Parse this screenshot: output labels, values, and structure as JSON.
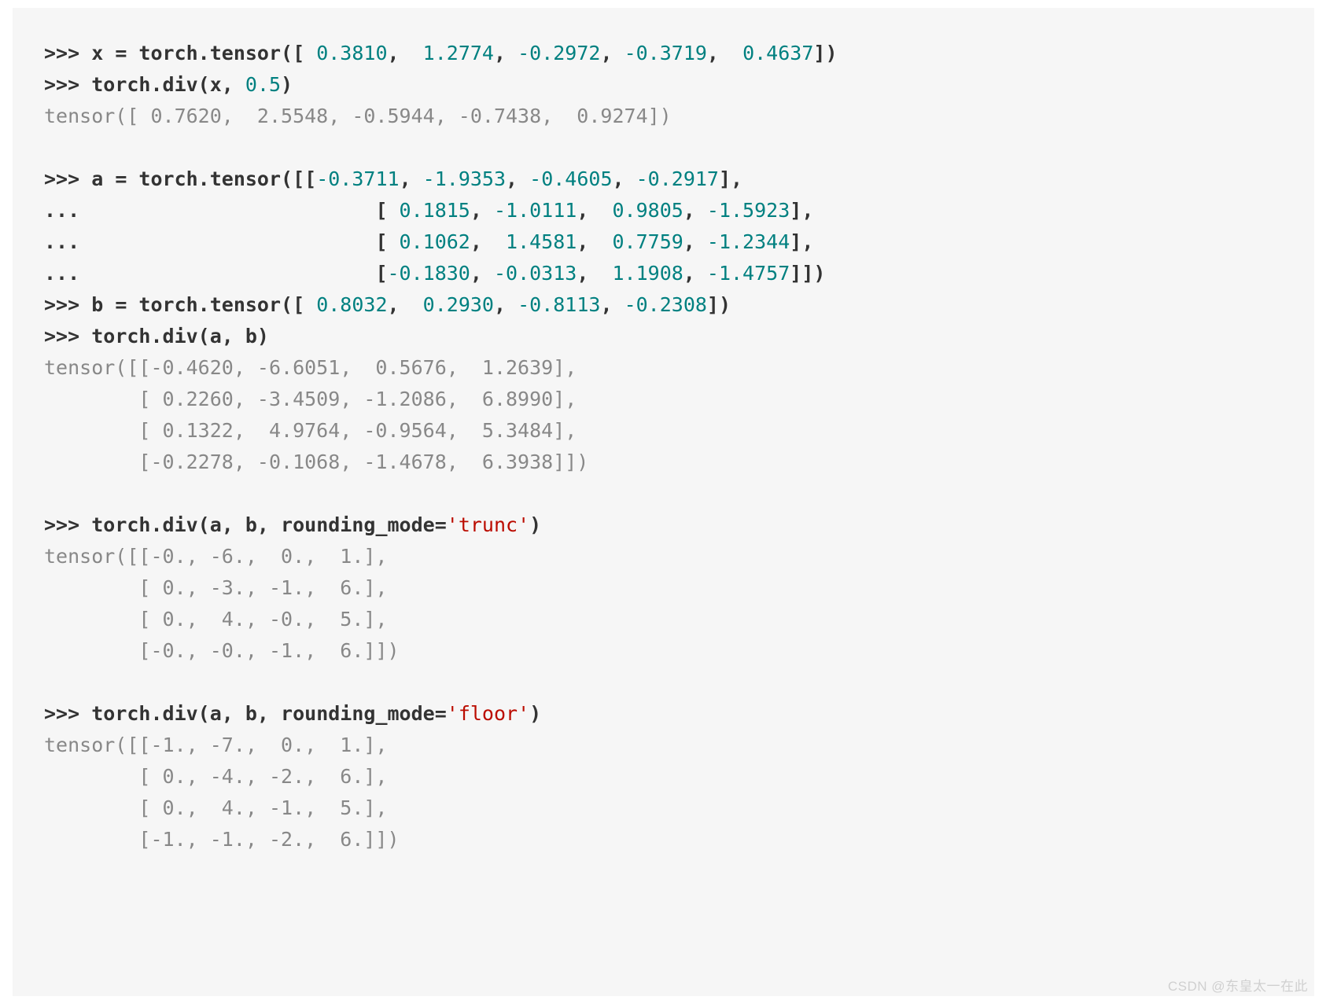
{
  "chart_data": {
    "type": "table",
    "title": "Python REPL session demonstrating torch.div",
    "inputs": [
      {
        "stmt": "x = torch.tensor([ 0.3810,  1.2774, -0.2972, -0.3719,  0.4637])"
      },
      {
        "stmt": "torch.div(x, 0.5)",
        "output": "tensor([ 0.7620,  2.5548, -0.5944, -0.7438,  0.9274])"
      },
      {
        "stmt": "a = torch.tensor([[-0.3711, -1.9353, -0.4605, -0.2917],[ 0.1815, -1.0111,  0.9805, -1.5923],[ 0.1062,  1.4581,  0.7759, -1.2344],[-0.1830, -0.0313,  1.1908, -1.4757]])"
      },
      {
        "stmt": "b = torch.tensor([ 0.8032,  0.2930, -0.8113, -0.2308])"
      },
      {
        "stmt": "torch.div(a, b)",
        "output": "tensor([[-0.4620, -6.6051,  0.5676,  1.2639],[ 0.2260, -3.4509, -1.2086,  6.8990],[ 0.1322,  4.9764, -0.9564,  5.3484],[-0.2278, -0.1068, -1.4678,  6.3938]])"
      },
      {
        "stmt": "torch.div(a, b, rounding_mode='trunc')",
        "output": "tensor([[-0., -6.,  0.,  1.],[ 0., -3., -1.,  6.],[ 0.,  4., -0.,  5.],[-0., -0., -1.,  6.]])"
      },
      {
        "stmt": "torch.div(a, b, rounding_mode='floor')",
        "output": "tensor([[-1., -7.,  0.,  1.],[ 0., -4., -2.,  6.],[ 0.,  4., -1.,  5.],[-1., -1., -2.,  6.]])"
      }
    ]
  },
  "tok": {
    "prompt": ">>> ",
    "cont": "...                         ",
    "x_assign": "x = torch.tensor([ ",
    "x_vals": [
      "0.3810",
      "1.2774",
      "-0.2972",
      "-0.3719",
      "0.4637"
    ],
    "x_close": "])",
    "divx_call": "torch.div(x, ",
    "divx_arg": "0.5",
    "divx_close": ")",
    "divx_out": "tensor([ 0.7620,  2.5548, -0.5944, -0.7438,  0.9274])",
    "a_assign": "a = torch.tensor([[",
    "a_r1": [
      "-0.3711",
      "-1.9353",
      "-0.4605",
      "-0.2917"
    ],
    "a_r2": [
      "0.1815",
      "-1.0111",
      "0.9805",
      "-1.5923"
    ],
    "a_r3": [
      "0.1062",
      "1.4581",
      "0.7759",
      "-1.2344"
    ],
    "a_r4": [
      "-0.1830",
      "-0.0313",
      "1.1908",
      "-1.4757"
    ],
    "row_open_sp": "[ ",
    "row_open": "[",
    "row_close_c": "],",
    "row_close_e": "]])",
    "b_assign": "b = torch.tensor([ ",
    "b_vals": [
      "0.8032",
      "0.2930",
      "-0.8113",
      "-0.2308"
    ],
    "b_close": "])",
    "divab": "torch.div(a, b)",
    "divab_out1": "tensor([[-0.4620, -6.6051,  0.5676,  1.2639],",
    "divab_out2": "        [ 0.2260, -3.4509, -1.2086,  6.8990],",
    "divab_out3": "        [ 0.1322,  4.9764, -0.9564,  5.3484],",
    "divab_out4": "        [-0.2278, -0.1068, -1.4678,  6.3938]])",
    "divtrunc_pre": "torch.div(a, b, rounding_mode=",
    "str_trunc": "'trunc'",
    "close_paren": ")",
    "trunc_out1": "tensor([[-0., -6.,  0.,  1.],",
    "trunc_out2": "        [ 0., -3., -1.,  6.],",
    "trunc_out3": "        [ 0.,  4., -0.,  5.],",
    "trunc_out4": "        [-0., -0., -1.,  6.]])",
    "divfloor_pre": "torch.div(a, b, rounding_mode=",
    "str_floor": "'floor'",
    "floor_out1": "tensor([[-1., -7.,  0.,  1.],",
    "floor_out2": "        [ 0., -4., -2.,  6.],",
    "floor_out3": "        [ 0.,  4., -1.,  5.],",
    "floor_out4": "        [-1., -1., -2.,  6.]])",
    "sep2": ",  ",
    "sep3": ",   ",
    "sep2b": ", ",
    "spc": " "
  },
  "watermark": "CSDN @东皇太一在此"
}
